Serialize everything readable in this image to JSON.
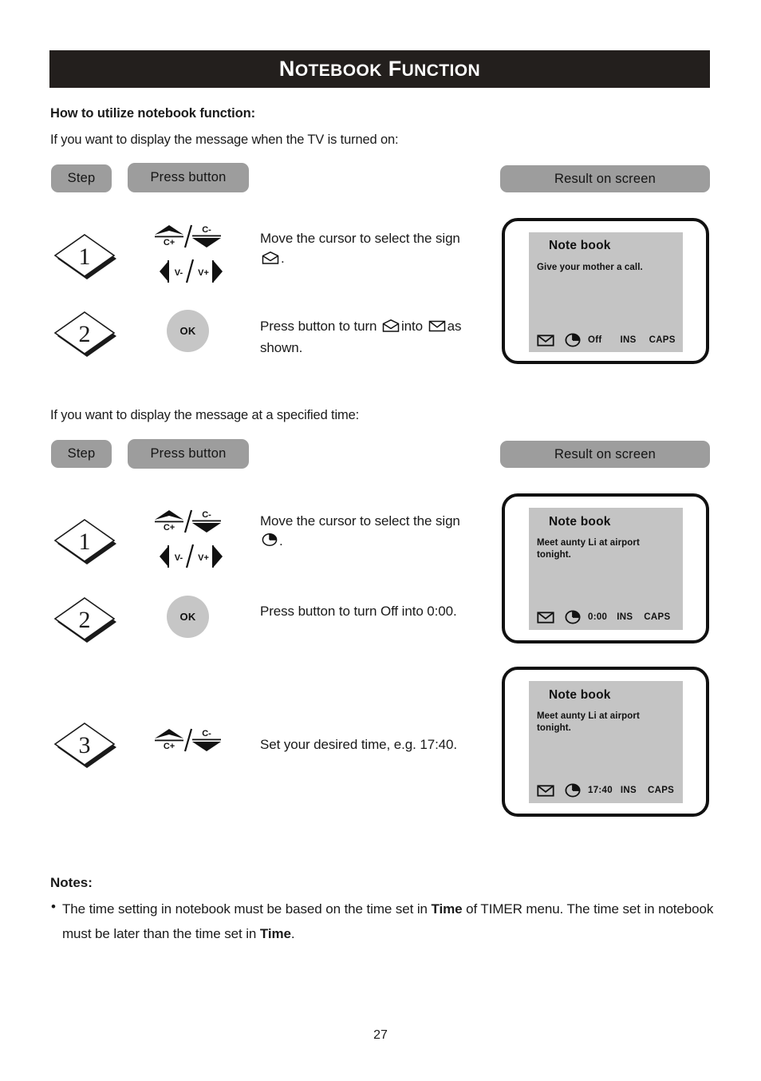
{
  "document": {
    "title": "Notebook Function",
    "page_number": "27"
  },
  "intro": {
    "heading": "How to utilize notebook function:",
    "line1": "If you want to display the message when the TV is turned on:",
    "line2": "If you want to display the message at a specified time:"
  },
  "column_headers": {
    "step": "Step",
    "press_button": "Press  button",
    "result": "Result  on  screen"
  },
  "keys": {
    "up_label": "C+",
    "down_label": "C-",
    "left_label": "V-",
    "right_label": "V+",
    "ok_label": "OK"
  },
  "section1": {
    "steps": [
      {
        "number": "1",
        "control": "cursor-keys",
        "text_before": "Move the cursor to select the sign",
        "icon": "envelope-open-icon",
        "text_after": "."
      },
      {
        "number": "2",
        "control": "ok-button",
        "text_before": "Press button to turn",
        "icon": "envelope-open-icon",
        "text_middle": "into",
        "icon2": "envelope-closed-icon",
        "text_after": "as shown."
      }
    ],
    "screens": [
      {
        "title": "Note book",
        "message": "Give your mother a call.",
        "status": {
          "mail_icon": "envelope-closed-icon",
          "clock_icon": "clock-icon",
          "time": "Off",
          "ins": "INS",
          "caps": "CAPS"
        }
      }
    ]
  },
  "section2": {
    "steps": [
      {
        "number": "1",
        "control": "cursor-keys",
        "text_before": "Move the cursor to select the sign",
        "icon": "clock-icon",
        "text_after": "."
      },
      {
        "number": "2",
        "control": "ok-button",
        "text_before": "Press button to turn Off into 0:00."
      },
      {
        "number": "3",
        "control": "updown-keys",
        "text_before": "Set your desired time, e.g. 17:40."
      }
    ],
    "screens": [
      {
        "title": "Note book",
        "message": "Meet aunty Li at airport tonight.",
        "status": {
          "mail_icon": "envelope-closed-icon",
          "clock_icon": "clock-icon",
          "time": "0:00",
          "ins": "INS",
          "caps": "CAPS"
        }
      },
      {
        "title": "Note book",
        "message": "Meet aunty Li at airport tonight.",
        "status": {
          "mail_icon": "envelope-closed-icon",
          "clock_icon": "clock-icon",
          "time": "17:40",
          "ins": "INS",
          "caps": "CAPS"
        }
      }
    ]
  },
  "notes": {
    "title": "Notes:",
    "bullet": "•",
    "text_1": "The time setting in notebook must be based on the time set in ",
    "bold_1": "Time",
    "text_2": " of TIMER menu. The time set in notebook must be later than the time set in ",
    "bold_2": "Time",
    "text_3": "."
  },
  "colors": {
    "banner_bg": "#231f1d",
    "pill_bg": "#9d9d9d",
    "screen_bg": "#c4c4c4",
    "ok_bg": "#c6c6c6"
  }
}
